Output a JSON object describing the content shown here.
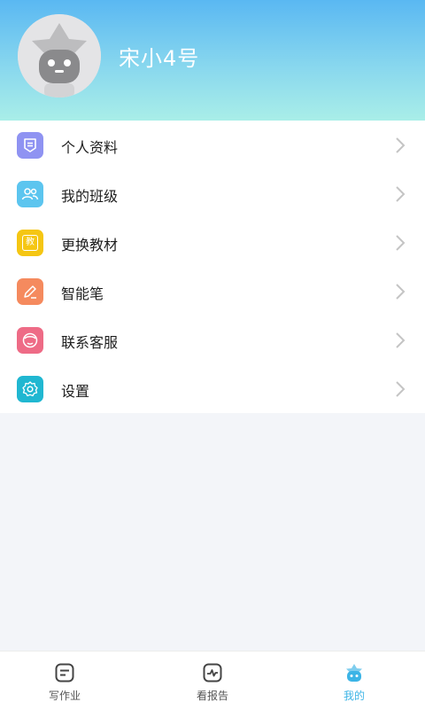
{
  "profile": {
    "username": "宋小4号"
  },
  "menu": {
    "items": [
      {
        "label": "个人资料",
        "icon": "profile-card-icon",
        "color": "#8f93f2"
      },
      {
        "label": "我的班级",
        "icon": "class-group-icon",
        "color": "#5cc5ef"
      },
      {
        "label": "更换教材",
        "icon": "textbook-icon",
        "color": "#f5c613"
      },
      {
        "label": "智能笔",
        "icon": "smart-pen-icon",
        "color": "#f58a5e"
      },
      {
        "label": "联系客服",
        "icon": "customer-service-icon",
        "color": "#ee6b86"
      },
      {
        "label": "设置",
        "icon": "settings-gear-icon",
        "color": "#20b7d1"
      }
    ],
    "textbook_icon_char": "教"
  },
  "tabbar": {
    "tabs": [
      {
        "label": "写作业",
        "icon": "homework-icon",
        "active": false
      },
      {
        "label": "看报告",
        "icon": "report-icon",
        "active": false
      },
      {
        "label": "我的",
        "icon": "mine-icon",
        "active": true
      }
    ],
    "active_color": "#3cb4e6"
  }
}
